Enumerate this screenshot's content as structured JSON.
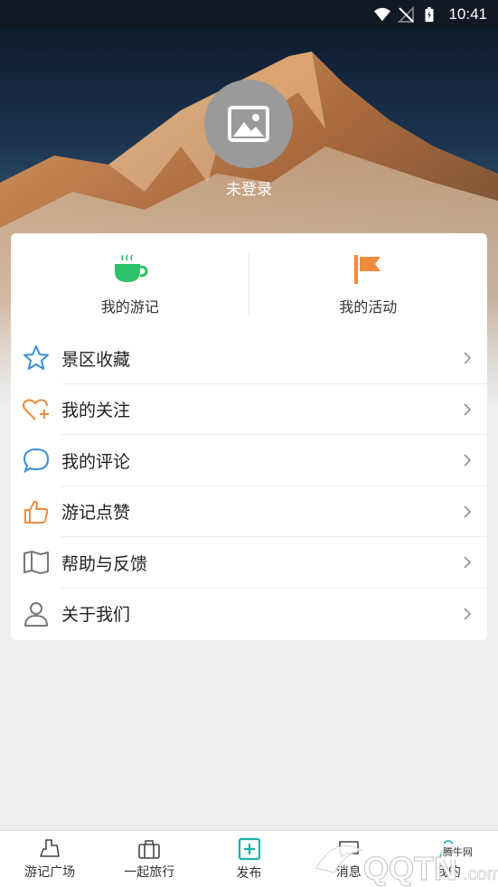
{
  "status_bar": {
    "time": "10:41"
  },
  "profile": {
    "login_status": "未登录"
  },
  "top_actions": [
    {
      "label": "我的游记",
      "icon": "tea-cup-icon",
      "color": "#2ec26a"
    },
    {
      "label": "我的活动",
      "icon": "flag-icon",
      "color": "#f08a3c"
    }
  ],
  "menu": [
    {
      "label": "景区收藏",
      "icon": "star-icon"
    },
    {
      "label": "我的关注",
      "icon": "heart-plus-icon"
    },
    {
      "label": "我的评论",
      "icon": "comment-icon"
    },
    {
      "label": "游记点赞",
      "icon": "thumbs-up-icon"
    },
    {
      "label": "帮助与反馈",
      "icon": "book-icon"
    },
    {
      "label": "关于我们",
      "icon": "user-icon"
    }
  ],
  "bottom_nav": [
    {
      "label": "游记广场",
      "icon": "travel-square-icon"
    },
    {
      "label": "一起旅行",
      "icon": "suitcase-icon"
    },
    {
      "label": "发布",
      "icon": "add-icon"
    },
    {
      "label": "消息",
      "icon": "message-icon"
    },
    {
      "label": "我的",
      "icon": "profile-icon"
    }
  ],
  "watermark": {
    "text": "腾牛网"
  },
  "colors": {
    "accent_green": "#2ec26a",
    "accent_orange": "#f08a3c",
    "accent_blue": "#3a8fd6",
    "publish_teal": "#1ab3a8"
  }
}
